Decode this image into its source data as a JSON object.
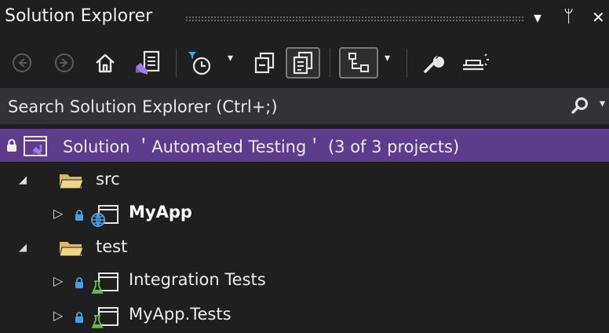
{
  "window": {
    "title": "Solution Explorer",
    "dropdown_glyph": "▾",
    "pin_glyph": "ᛘ",
    "close_glyph": "✕"
  },
  "toolbar": {
    "buttons": [
      {
        "name": "back",
        "icon": "arrow-left-circle-icon",
        "enabled": false
      },
      {
        "name": "forward",
        "icon": "arrow-right-circle-icon",
        "enabled": false
      },
      {
        "name": "home",
        "icon": "home-icon",
        "enabled": true
      },
      {
        "name": "switch-views",
        "icon": "vs-switch-views-icon",
        "enabled": true
      },
      {
        "name": "pending-changes-filter",
        "icon": "clock-filter-icon",
        "enabled": true
      },
      {
        "name": "collapse-all",
        "icon": "collapse-all-icon",
        "enabled": true
      },
      {
        "name": "show-all-files",
        "icon": "show-all-files-icon",
        "enabled": true,
        "pressed": true
      },
      {
        "name": "sync-active-document",
        "icon": "tree-sync-icon",
        "enabled": true,
        "pressed": true
      },
      {
        "name": "properties",
        "icon": "wrench-icon",
        "enabled": true
      },
      {
        "name": "preview-selected",
        "icon": "preview-icon",
        "enabled": true
      }
    ]
  },
  "search": {
    "placeholder": "Search Solution Explorer (Ctrl+;)"
  },
  "tree": {
    "solution_label": "Solution ＇Automated Testing＇ (3 of 3 projects)",
    "expand_glyph": "◢",
    "collapse_glyph": "▷",
    "lock_glyph": "🔒︎",
    "items": [
      {
        "label": "src",
        "kind": "folder",
        "expanded": true
      },
      {
        "label": "MyApp",
        "kind": "web-project",
        "bold": true
      },
      {
        "label": "test",
        "kind": "folder",
        "expanded": true
      },
      {
        "label": "Integration Tests",
        "kind": "test-project"
      },
      {
        "label": "MyApp.Tests",
        "kind": "test-project"
      }
    ]
  },
  "colors": {
    "background": "#1f1f1f",
    "search_background": "#333337",
    "selection": "#5e3c8c",
    "vs_purple": "#a07ce8",
    "folder_yellow": "#d8b86a",
    "test_green": "#6abf4b",
    "web_blue": "#4aa0e8"
  }
}
